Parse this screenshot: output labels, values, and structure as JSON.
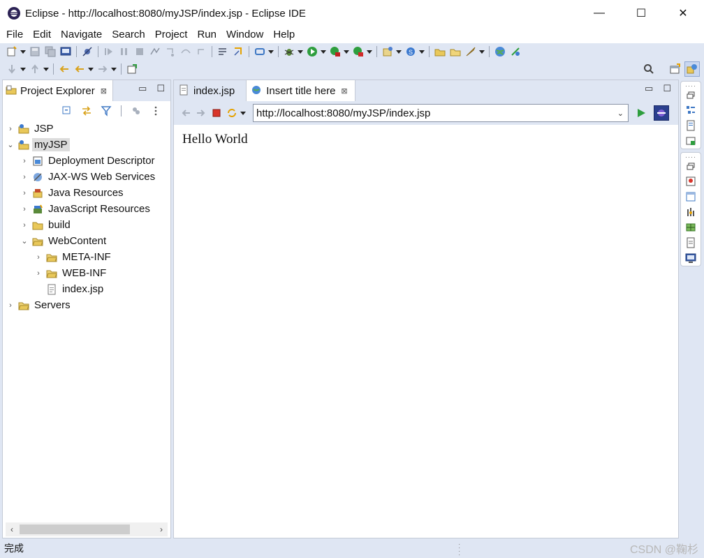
{
  "window": {
    "title": "Eclipse - http://localhost:8080/myJSP/index.jsp - Eclipse IDE",
    "minimize": "—",
    "maximize": "☐",
    "close": "✕"
  },
  "menu": [
    "File",
    "Edit",
    "Navigate",
    "Search",
    "Project",
    "Run",
    "Window",
    "Help"
  ],
  "project_explorer": {
    "tab_label": "Project Explorer",
    "tab_close": "⊠",
    "view_menu_min": "▭",
    "view_menu_max": "☐",
    "tree": [
      {
        "label": "JSP",
        "expanded": false,
        "icon": "project-icon"
      },
      {
        "label": "myJSP",
        "expanded": true,
        "selected": true,
        "icon": "web-project-icon"
      },
      {
        "label": "Deployment Descriptor",
        "icon": "deployment-descriptor-icon"
      },
      {
        "label": "JAX-WS Web Services",
        "icon": "web-services-icon"
      },
      {
        "label": "Java Resources",
        "icon": "java-resources-icon"
      },
      {
        "label": "JavaScript Resources",
        "icon": "javascript-resources-icon"
      },
      {
        "label": "build",
        "icon": "folder-icon"
      },
      {
        "label": "WebContent",
        "expanded": true,
        "icon": "folder-open-icon"
      },
      {
        "label": "META-INF",
        "icon": "folder-icon"
      },
      {
        "label": "WEB-INF",
        "icon": "folder-icon"
      },
      {
        "label": "index.jsp",
        "icon": "jsp-file-icon"
      },
      {
        "label": "Servers",
        "icon": "folder-icon"
      }
    ]
  },
  "editor": {
    "tabs": [
      {
        "label": "index.jsp",
        "active": false,
        "icon": "jsp-file-icon"
      },
      {
        "label": "Insert title here",
        "active": true,
        "icon": "globe-icon",
        "close": "⊠"
      }
    ],
    "url": "http://localhost:8080/myJSP/index.jsp",
    "page_text": "Hello World"
  },
  "status": {
    "text": "完成"
  },
  "watermark": "CSDN @鞠杉",
  "colors": {
    "chrome": "#dfe6f3",
    "border": "#c4cad6",
    "selection": "#dcdcdc"
  }
}
